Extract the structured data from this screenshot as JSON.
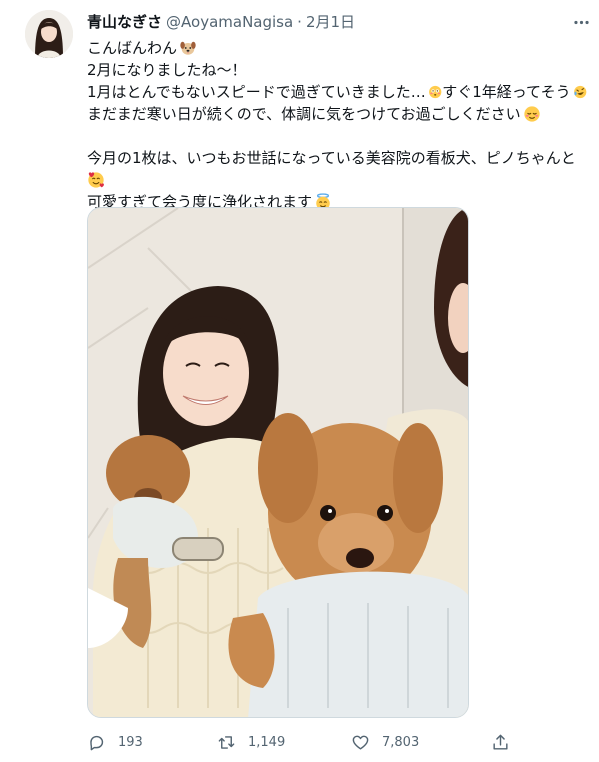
{
  "tweet": {
    "author": {
      "display_name": "青山なぎさ",
      "handle": "@AoyamaNagisa",
      "separator": "·",
      "date": "2月1日"
    },
    "lines": [
      "こんばんわん",
      "2月になりましたね〜！",
      "1月はとんでもないスピードで過ぎていきました…",
      "すぐ1年経ってそう",
      "まだまだ寒い日が続くので、体調に気をつけてお過ごしください",
      "今月の1枚は、いつもお世話になっている美容院の看板犬、ピノちゃんと",
      "可愛すぎて会う度に浄化されます"
    ],
    "emojis": [
      "dog-face",
      "flushed-face",
      "rolling-on-floor-laughing",
      "relieved-face",
      "smiling-face-with-hearts",
      "smiling-face-with-halo"
    ],
    "photo": {
      "alt": "",
      "colors": {
        "wall": "#ece7df",
        "sweater": "#f3ead3",
        "dog": "#c98a4f",
        "hair": "#2c1d16"
      }
    },
    "actions": {
      "replies": "193",
      "retweets": "1,149",
      "likes": "7,803"
    },
    "colors": {
      "text": "#0f1419",
      "secondary": "#536471",
      "border": "#cfd9de"
    }
  }
}
